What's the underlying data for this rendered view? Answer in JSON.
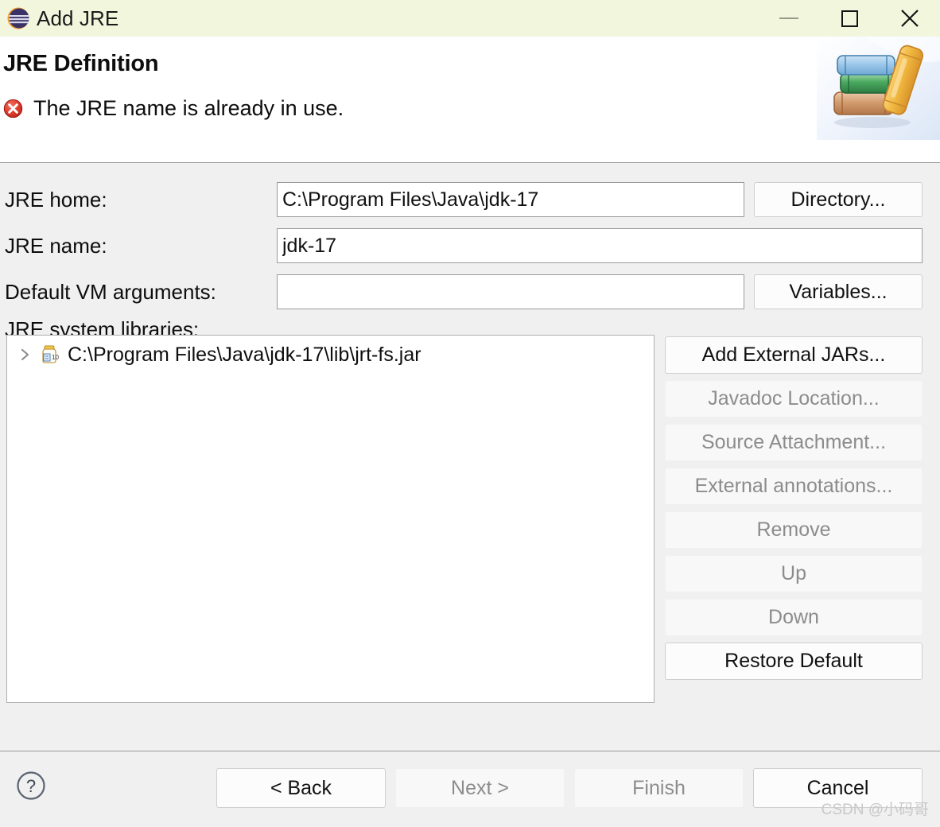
{
  "window": {
    "title": "Add JRE",
    "app_icon": "eclipse-logo-icon",
    "controls": {
      "minimize": "minimize-icon",
      "maximize": "maximize-icon",
      "close": "close-icon"
    }
  },
  "header": {
    "title": "JRE Definition",
    "status_icon": "error-icon",
    "message": "The JRE name is already in use.",
    "banner_icon": "books-stack-icon"
  },
  "form": {
    "jre_home": {
      "label": "JRE home:",
      "value": "C:\\Program Files\\Java\\jdk-17",
      "placeholder": "",
      "button": "Directory..."
    },
    "jre_name": {
      "label": "JRE name:",
      "value": "jdk-17",
      "placeholder": ""
    },
    "vm_args": {
      "label": "Default VM arguments:",
      "value": "",
      "placeholder": "",
      "button": "Variables..."
    },
    "libraries": {
      "label": "JRE system libraries:"
    }
  },
  "tree": {
    "items": [
      {
        "expander": "chevron-right-icon",
        "icon": "jar-file-icon",
        "label": "C:\\Program Files\\Java\\jdk-17\\lib\\jrt-fs.jar"
      }
    ]
  },
  "side_buttons": [
    {
      "label": "Add External JARs...",
      "enabled": true
    },
    {
      "label": "Javadoc Location...",
      "enabled": false
    },
    {
      "label": "Source Attachment...",
      "enabled": false
    },
    {
      "label": "External annotations...",
      "enabled": false
    },
    {
      "label": "Remove",
      "enabled": false
    },
    {
      "label": "Up",
      "enabled": false
    },
    {
      "label": "Down",
      "enabled": false
    },
    {
      "label": "Restore Default",
      "enabled": true
    }
  ],
  "footer": {
    "help_icon": "help-question-icon",
    "buttons": [
      {
        "label": "< Back",
        "enabled": true
      },
      {
        "label": "Next >",
        "enabled": false
      },
      {
        "label": "Finish",
        "enabled": false
      },
      {
        "label": "Cancel",
        "enabled": true
      }
    ]
  },
  "watermark": "CSDN @小码哥",
  "colors": {
    "titlebar_bg": "#f1f6dc",
    "header_bg": "#ffffff",
    "body_bg": "#f0f0f0",
    "error_red": "#d93025",
    "disabled_text": "#8c8c8c"
  }
}
